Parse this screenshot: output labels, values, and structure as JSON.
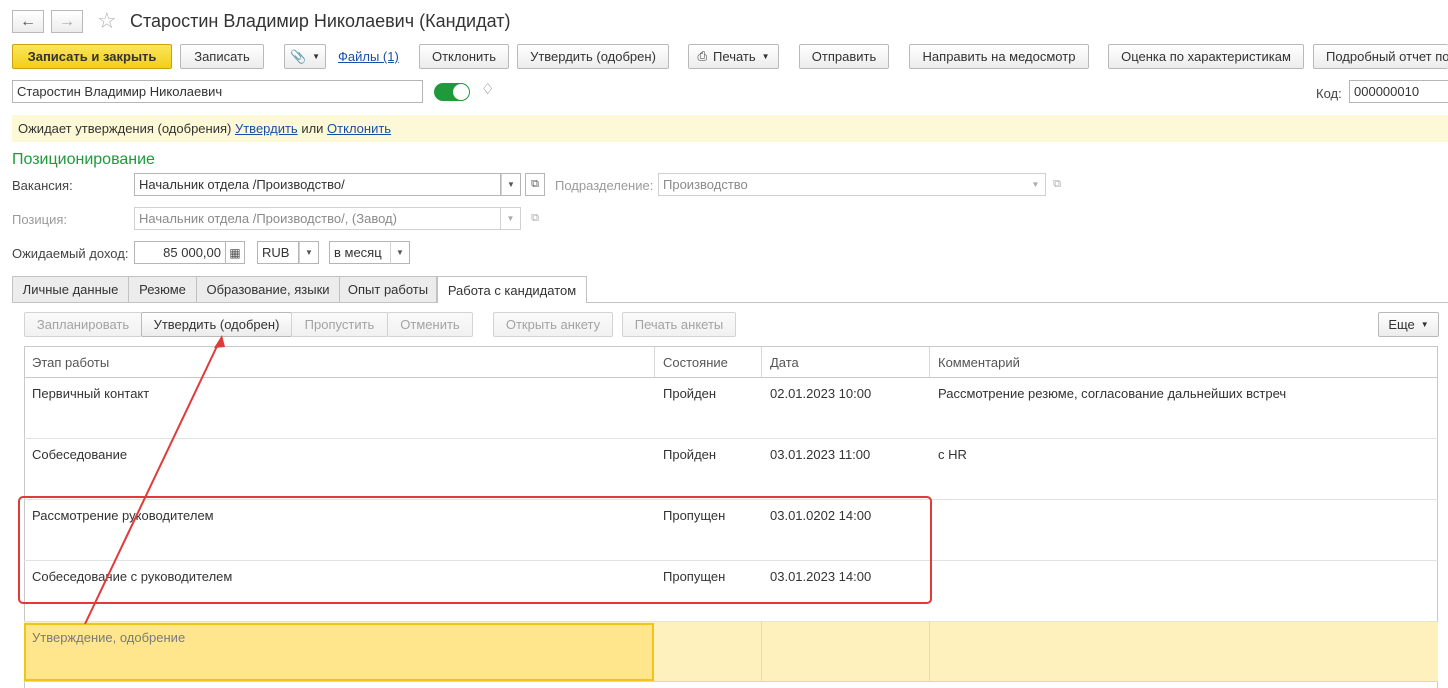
{
  "window": {
    "title": "Старостин Владимир Николаевич (Кандидат)"
  },
  "nav": {
    "back_icon": "arrow-left",
    "forward_icon": "arrow-right",
    "favorite_icon": "star"
  },
  "toolbar": {
    "save_close": "Записать и закрыть",
    "save": "Записать",
    "files": "Файлы (1)",
    "reject": "Отклонить",
    "approve": "Утвердить (одобрен)",
    "print": "Печать",
    "send": "Отправить",
    "medical": "Направить на медосмотр",
    "evaluate": "Оценка по характеристикам",
    "report": "Подробный отчет по"
  },
  "header": {
    "name_value": "Старостин Владимир Николаевич",
    "code_label": "Код:",
    "code_value": "000000010"
  },
  "notice": {
    "text": "Ожидает утверждения (одобрения)",
    "approve_link": "Утвердить",
    "or": "или",
    "reject_link": "Отклонить",
    "bg_color": "#fdf9d6"
  },
  "positioning": {
    "section_title": "Позиционирование",
    "vacancy_label": "Вакансия:",
    "vacancy_value": "Начальник отдела /Производство/",
    "department_label": "Подразделение:",
    "department_value": "Производство",
    "position_label": "Позиция:",
    "position_value": "Начальник отдела /Производство/, (Завод)",
    "income_label": "Ожидаемый доход:",
    "income_value": "85 000,00",
    "currency_value": "RUB",
    "period_value": "в месяц"
  },
  "tabs": [
    {
      "label": "Личные данные",
      "active": false
    },
    {
      "label": "Резюме",
      "active": false
    },
    {
      "label": "Образование, языки",
      "active": false
    },
    {
      "label": "Опыт работы",
      "active": false
    },
    {
      "label": "Работа с кандидатом",
      "active": true
    }
  ],
  "stage_toolbar": {
    "plan": "Запланировать",
    "approve": "Утвердить (одобрен)",
    "skip": "Пропустить",
    "cancel": "Отменить",
    "open_form": "Открыть анкету",
    "print_form": "Печать анкеты",
    "more": "Еще"
  },
  "table": {
    "columns": [
      "Этап работы",
      "Состояние",
      "Дата",
      "Комментарий"
    ],
    "rows": [
      {
        "stage": "Первичный контакт",
        "state": "Пройден",
        "date": "02.01.2023 10:00",
        "comment": "Рассмотрение резюме, согласование дальнейших встреч"
      },
      {
        "stage": "Собеседование",
        "state": "Пройден",
        "date": "03.01.2023 11:00",
        "comment": "с HR"
      },
      {
        "stage": "Рассмотрение руководителем",
        "state": "Пропущен",
        "date": "03.01.0202 14:00",
        "comment": ""
      },
      {
        "stage": "Собеседование с руководителем",
        "state": "Пропущен",
        "date": "03.01.2023 14:00",
        "comment": ""
      },
      {
        "stage": "Утверждение, одобрение",
        "state": "",
        "date": "",
        "comment": ""
      }
    ]
  },
  "colors": {
    "accent_green": "#1e9a3a",
    "highlight_red": "#e03a3a",
    "selected_row": "#fff1bd",
    "selected_cell": "#ffe68c"
  }
}
